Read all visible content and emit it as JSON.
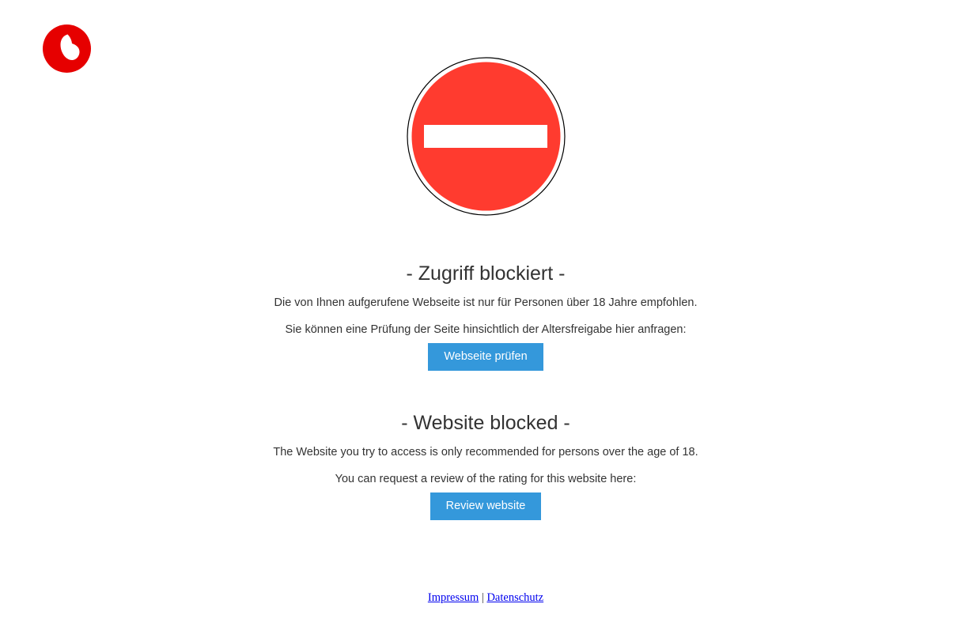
{
  "brand": {
    "logo_icon": "vodafone-logo-icon",
    "color": "#e60000"
  },
  "sign": {
    "icon": "no-entry-sign-icon",
    "color": "#ff3b2f"
  },
  "german": {
    "title": "- Zugriff blockiert -",
    "message": "Die von Ihnen aufgerufene Webseite ist nur für Personen über 18 Jahre empfohlen.",
    "request_text": "Sie können eine Prüfung der Seite hinsichtlich der Altersfreigabe hier anfragen:",
    "button_label": "Webseite prüfen"
  },
  "english": {
    "title": "- Website blocked -",
    "message": "The Website you try to access is only recommended for persons over the age of 18.",
    "request_text": "You can request a review of the rating for this website here:",
    "button_label": "Review website"
  },
  "button_color": "#3498db",
  "footer": {
    "impressum": "Impressum",
    "separator": "|",
    "datenschutz": "Datenschutz"
  }
}
